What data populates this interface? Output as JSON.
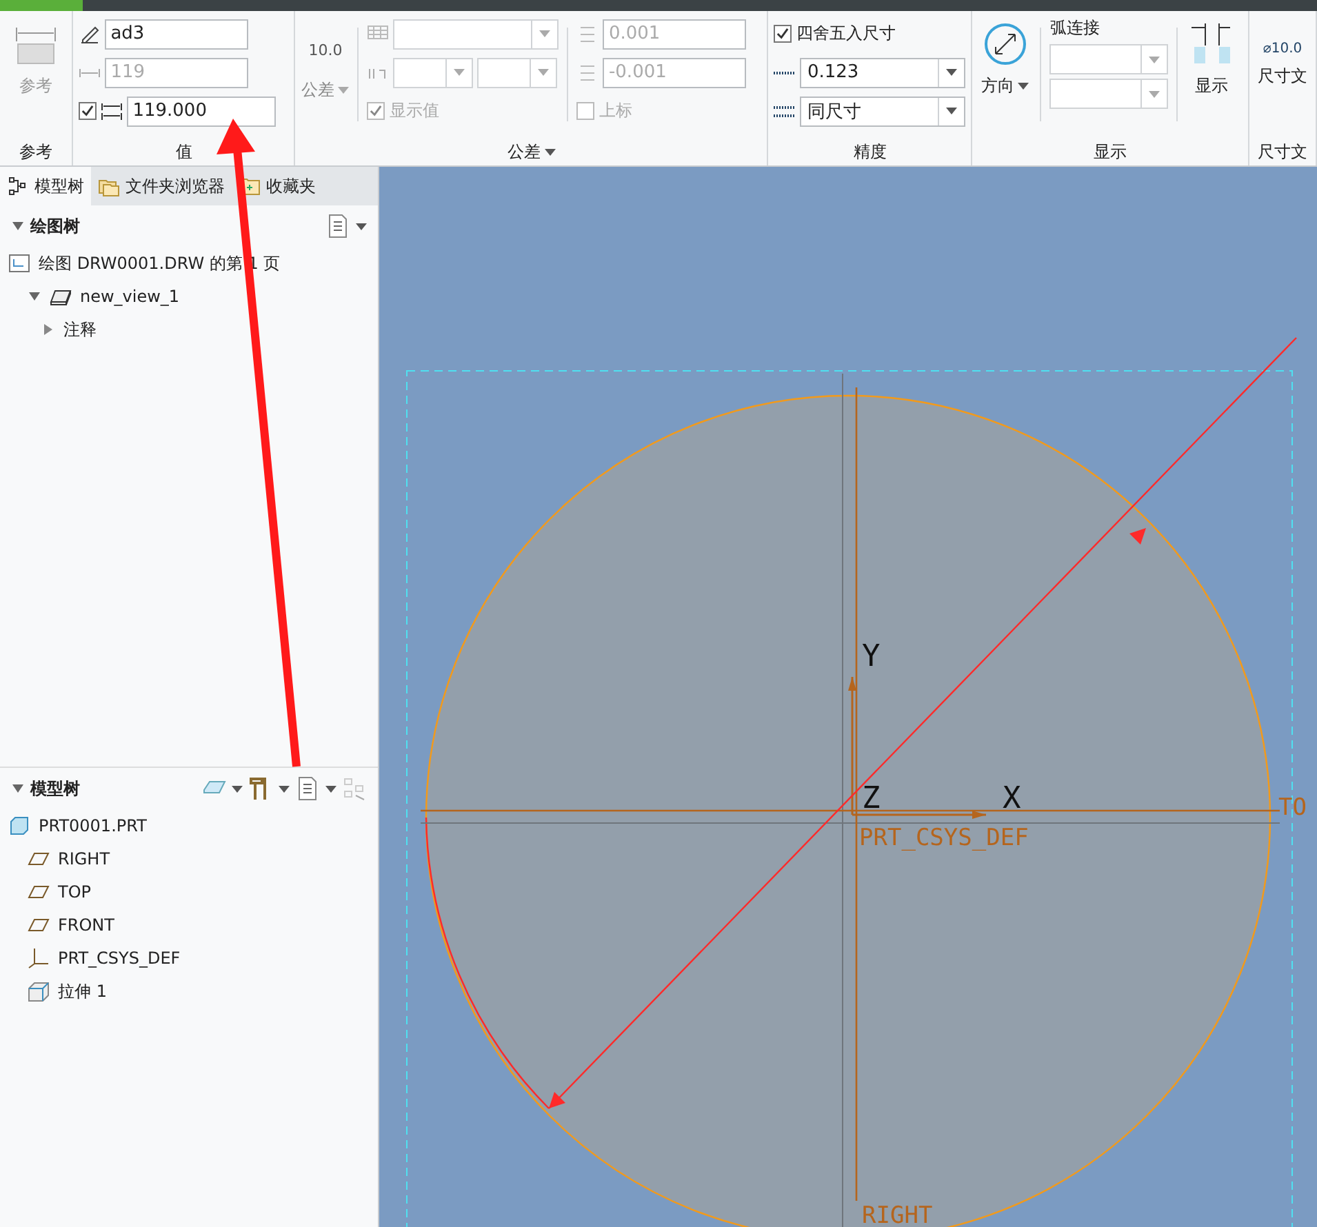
{
  "ribbon": {
    "reference": {
      "button": "参考",
      "group": "参考"
    },
    "value": {
      "name": "ad3",
      "nominal": "119",
      "override_checked": true,
      "override": "119.000",
      "group": "值"
    },
    "tolerance": {
      "display": "10.0",
      "menu": "公差",
      "upper": "0.001",
      "lower": "-0.001",
      "show_value": {
        "label": "显示值",
        "checked": true
      },
      "superscript": {
        "label": "上标",
        "checked": false
      },
      "group": "公差"
    },
    "precision": {
      "round": {
        "label": "四舍五入尺寸",
        "checked": true
      },
      "decimals": "0.123",
      "tol_decimals": "同尺寸",
      "group": "精度"
    },
    "display": {
      "direction": "方向",
      "arc": "弧连接",
      "show": "显示",
      "group": "显示"
    },
    "dim_text": {
      "preview": "⌀10.0",
      "button": "尺寸文",
      "group": "尺寸文"
    }
  },
  "tabs": [
    {
      "label": "模型树",
      "selected": true
    },
    {
      "label": "文件夹浏览器",
      "selected": false
    },
    {
      "label": "收藏夹",
      "selected": false
    }
  ],
  "drawing_tree": {
    "title": "绘图树",
    "items": [
      {
        "label": "绘图 DRW0001.DRW 的第 1 页",
        "kind": "sheet"
      },
      {
        "label": "new_view_1",
        "kind": "view",
        "expanded": true,
        "children": [
          {
            "label": "注释",
            "expanded": false
          }
        ]
      }
    ]
  },
  "model_tree": {
    "title": "模型树",
    "items": [
      {
        "label": "PRT0001.PRT",
        "kind": "part",
        "children": [
          {
            "label": "RIGHT",
            "kind": "plane"
          },
          {
            "label": "TOP",
            "kind": "plane"
          },
          {
            "label": "FRONT",
            "kind": "plane"
          },
          {
            "label": "PRT_CSYS_DEF",
            "kind": "csys"
          },
          {
            "label": "拉伸 1",
            "kind": "extrude"
          }
        ]
      }
    ]
  },
  "canvas": {
    "y_label": "Y",
    "z_label": "Z",
    "x_label": "X",
    "csys_label": "PRT_CSYS_DEF",
    "top_label": "TO",
    "right_label": "RIGHT"
  }
}
